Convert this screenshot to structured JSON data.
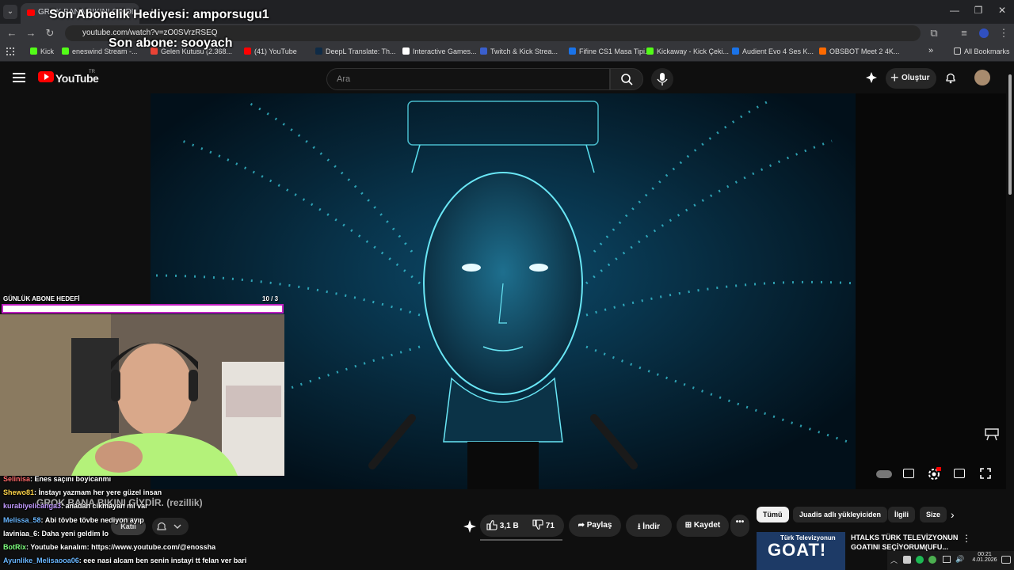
{
  "browser": {
    "tab_title": "GROK BANA BIKINI GIYDI...",
    "new_tab": "+",
    "url": "youtube.com/watch?v=zO0SVrzRSEQ",
    "bookmarks": [
      {
        "label": "Kick",
        "color": "#53fc18"
      },
      {
        "label": "eneswind Stream -...",
        "color": "#53fc18"
      },
      {
        "label": "Gelen Kutusu (2.368...",
        "color": "#ea4335"
      },
      {
        "label": "(41) YouTube",
        "color": "#ff0000"
      },
      {
        "label": "DeepL Translate: Th...",
        "color": "#0f2b46"
      },
      {
        "label": "Interactive Games...",
        "color": "#ffffff"
      },
      {
        "label": "Twitch & Kick Strea...",
        "color": "#3a5fcd"
      },
      {
        "label": "Fifine CS1 Masa Tipi...",
        "color": "#1a73e8"
      },
      {
        "label": "Kickaway - Kick Çeki...",
        "color": "#53fc18"
      },
      {
        "label": "Audient Evo 4 Ses K...",
        "color": "#1a73e8"
      },
      {
        "label": "OBSBOT Meet 2 4K...",
        "color": "#ff6a00"
      }
    ],
    "all_bookmarks": "All Bookmarks"
  },
  "youtube": {
    "logo_text": "YouTube",
    "region": "TR",
    "search_placeholder": "Ara",
    "create_label": "Oluştur",
    "video_title_overlay": "GROK BANA BIKINI GİYDİR. (rezillik)",
    "likes": "3,1 B",
    "dislikes": "71",
    "share": "Paylaş",
    "download": "İndir",
    "save": "Kaydet",
    "subscribe": "Katıl",
    "chips": [
      "Tümü",
      "Juadis adlı yükleyiciden",
      "İlgili",
      "Size"
    ],
    "recommended_title": "HTALKS TÜRK TELEVİZYONUN GOATINI SEÇİYORUM(UFU...",
    "recommended_thumb_text": "GOAT!",
    "recommended_thumb_sub": "Türk Televizyonun"
  },
  "stream_overlay": {
    "last_gift": "Son Abonelik Hediyesi: amporsugu1",
    "last_sub": "Son abone: sooyach",
    "goal_label": "GÜNLÜK ABONE HEDEFİ",
    "goal_count": "10  / 3",
    "goal_progress": 1.0
  },
  "chat": [
    {
      "user": "Selinisa",
      "color": "#ff6b6b",
      "msg": ": Enes saçını boyicanmı"
    },
    {
      "user": "Shewo81",
      "color": "#ffd54a",
      "msg": ": İnstayı yazmam her yere güzel insan"
    },
    {
      "user": "kurabiyelicanga3",
      "color": "#c39bff",
      "msg": ": anadan cikmayan mi var"
    },
    {
      "user": "Melissa_58",
      "color": "#6ab7ff",
      "msg": ": Abi tövbe tövbe nediyon ayıp"
    },
    {
      "user": "laviniaa_6",
      "color": "#ffffff",
      "msg": ": Daha yeni geldim lo"
    },
    {
      "user": "BotRix",
      "color": "#7fff7f",
      "msg": ": Youtube kanalım: https://www.youtube.com/@enossha"
    },
    {
      "user": "Ayunlike_Melisaooa06",
      "color": "#6ab7ff",
      "msg": ": eee nasi alcam ben senin instayi tt felan ver bari"
    }
  ],
  "tray": {
    "time": "00:21",
    "date": "4.01.2026"
  },
  "colors": {
    "youtube_red": "#ff0000",
    "goal_border": "#c020c0",
    "kick_green": "#53fc18"
  }
}
